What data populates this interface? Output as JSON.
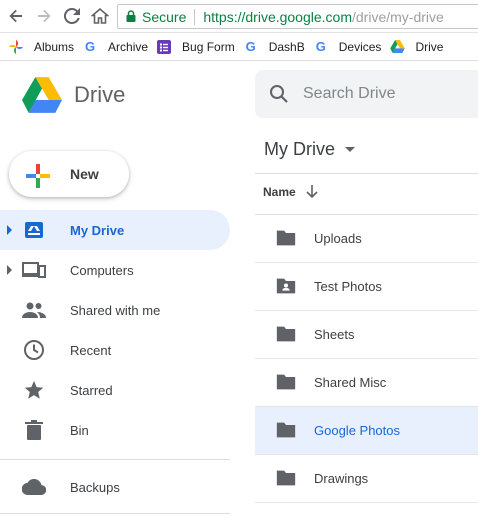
{
  "browser": {
    "secure_label": "Secure",
    "url_host": "https://drive.google.com",
    "url_path": "/drive/my-drive",
    "bookmarks": [
      {
        "label": "Albums",
        "icon": "pinwheel-icon"
      },
      {
        "label": "Archive",
        "icon": "google-g-icon"
      },
      {
        "label": "Bug Form",
        "icon": "forms-icon"
      },
      {
        "label": "DashB",
        "icon": "google-g-icon"
      },
      {
        "label": "Devices",
        "icon": "google-g-icon"
      },
      {
        "label": "Drive",
        "icon": "drive-icon"
      }
    ]
  },
  "header": {
    "brand": "Drive",
    "search_placeholder": "Search Drive"
  },
  "new_button": {
    "label": "New"
  },
  "sidebar": {
    "items": [
      {
        "label": "My Drive",
        "icon": "my-drive-icon",
        "active": true
      },
      {
        "label": "Computers",
        "icon": "computers-icon"
      },
      {
        "label": "Shared with me",
        "icon": "people-icon"
      },
      {
        "label": "Recent",
        "icon": "clock-icon"
      },
      {
        "label": "Starred",
        "icon": "star-icon"
      },
      {
        "label": "Bin",
        "icon": "trash-icon"
      },
      {
        "label": "Backups",
        "icon": "cloud-icon"
      }
    ]
  },
  "main": {
    "title": "My Drive",
    "column_name": "Name",
    "files": [
      {
        "name": "Uploads",
        "icon": "folder-icon"
      },
      {
        "name": "Test Photos",
        "icon": "shared-folder-icon"
      },
      {
        "name": "Sheets",
        "icon": "folder-icon"
      },
      {
        "name": "Shared Misc",
        "icon": "folder-icon"
      },
      {
        "name": "Google Photos",
        "icon": "folder-icon",
        "selected": true
      },
      {
        "name": "Drawings",
        "icon": "folder-icon"
      }
    ]
  },
  "colors": {
    "accent": "#1967d2",
    "active_bg": "#e8f0fe",
    "secure_green": "#0b8043"
  }
}
